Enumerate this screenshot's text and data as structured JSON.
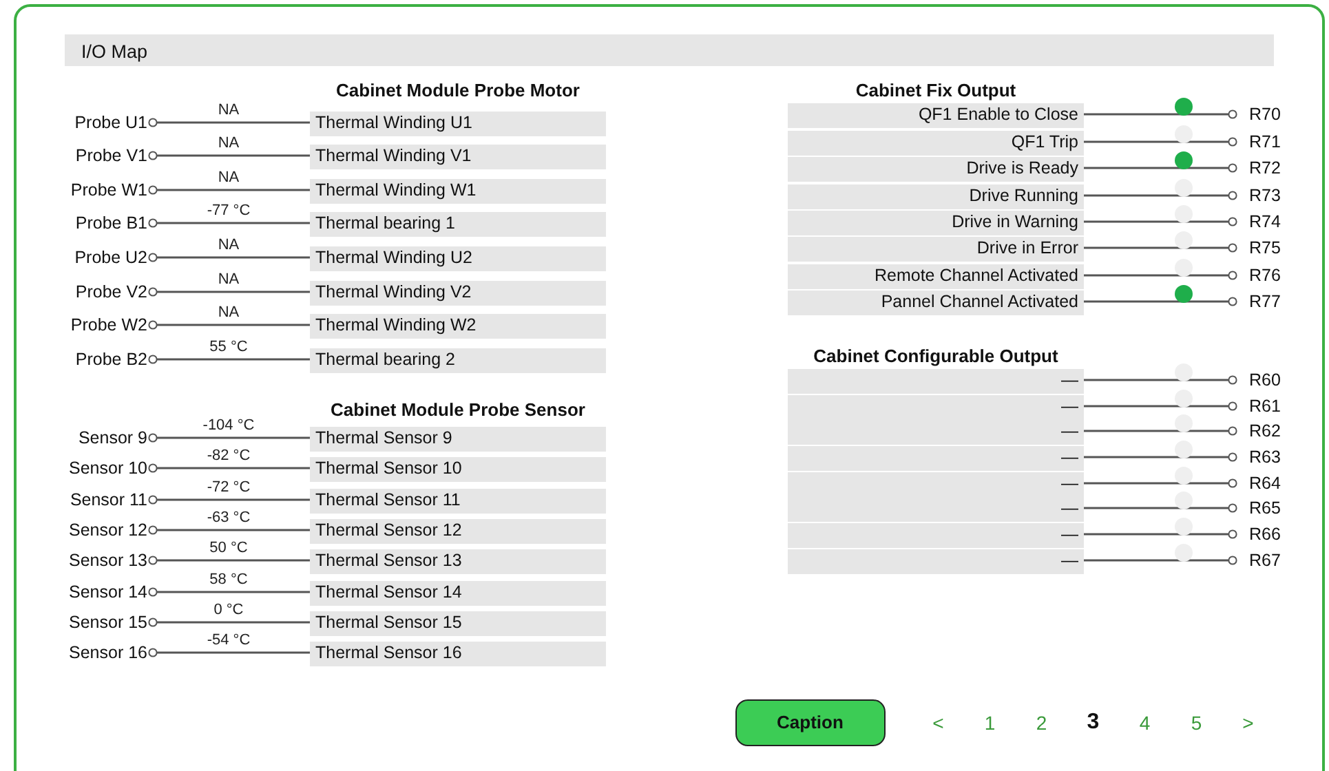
{
  "title": "I/O Map",
  "probe_motor": {
    "heading": "Cabinet Module Probe Motor",
    "rows": [
      {
        "label": "Probe U1",
        "value": "NA",
        "channel": "Thermal Winding U1"
      },
      {
        "label": "Probe V1",
        "value": "NA",
        "channel": "Thermal Winding V1"
      },
      {
        "label": "Probe W1",
        "value": "NA",
        "channel": "Thermal Winding W1"
      },
      {
        "label": "Probe B1",
        "value": "-77 °C",
        "channel": "Thermal bearing 1"
      },
      {
        "label": "Probe U2",
        "value": "NA",
        "channel": "Thermal Winding U2"
      },
      {
        "label": "Probe V2",
        "value": "NA",
        "channel": "Thermal Winding V2"
      },
      {
        "label": "Probe W2",
        "value": "NA",
        "channel": "Thermal Winding W2"
      },
      {
        "label": "Probe B2",
        "value": "55 °C",
        "channel": "Thermal bearing 2"
      }
    ]
  },
  "probe_sensor": {
    "heading": "Cabinet Module Probe Sensor",
    "rows": [
      {
        "label": "Sensor 9",
        "value": "-104 °C",
        "channel": "Thermal Sensor 9"
      },
      {
        "label": "Sensor 10",
        "value": "-82 °C",
        "channel": "Thermal Sensor 10"
      },
      {
        "label": "Sensor 11",
        "value": "-72 °C",
        "channel": "Thermal Sensor 11"
      },
      {
        "label": "Sensor 12",
        "value": "-63 °C",
        "channel": "Thermal Sensor 12"
      },
      {
        "label": "Sensor 13",
        "value": "50 °C",
        "channel": "Thermal Sensor 13"
      },
      {
        "label": "Sensor 14",
        "value": "58 °C",
        "channel": "Thermal Sensor 14"
      },
      {
        "label": "Sensor 15",
        "value": "0 °C",
        "channel": "Thermal Sensor 15"
      },
      {
        "label": "Sensor 16",
        "value": "-54 °C",
        "channel": "Thermal Sensor 16"
      }
    ]
  },
  "fix_output": {
    "heading": "Cabinet Fix Output",
    "rows": [
      {
        "label": "QF1 Enable to Close",
        "on": true,
        "terminal": "R70"
      },
      {
        "label": "QF1 Trip",
        "on": false,
        "terminal": "R71"
      },
      {
        "label": "Drive is Ready",
        "on": true,
        "terminal": "R72"
      },
      {
        "label": "Drive Running",
        "on": false,
        "terminal": "R73"
      },
      {
        "label": "Drive in Warning",
        "on": false,
        "terminal": "R74"
      },
      {
        "label": "Drive in Error",
        "on": false,
        "terminal": "R75"
      },
      {
        "label": "Remote Channel Activated",
        "on": false,
        "terminal": "R76"
      },
      {
        "label": "Pannel Channel Activated",
        "on": true,
        "terminal": "R77"
      }
    ]
  },
  "configurable_output": {
    "heading": "Cabinet Configurable Output",
    "rows": [
      {
        "label": "—",
        "on": false,
        "terminal": "R60"
      },
      {
        "label": "—",
        "on": false,
        "terminal": "R61"
      },
      {
        "label": "—",
        "on": false,
        "terminal": "R62"
      },
      {
        "label": "—",
        "on": false,
        "terminal": "R63"
      },
      {
        "label": "—",
        "on": false,
        "terminal": "R64"
      },
      {
        "label": "—",
        "on": false,
        "terminal": "R65"
      },
      {
        "label": "—",
        "on": false,
        "terminal": "R66"
      },
      {
        "label": "—",
        "on": false,
        "terminal": "R67"
      }
    ]
  },
  "caption_button": "Caption",
  "pagination": {
    "prev": "<",
    "next": ">",
    "pages": [
      {
        "label": "1",
        "selected": false
      },
      {
        "label": "2",
        "selected": false
      },
      {
        "label": "3",
        "selected": true
      },
      {
        "label": "4",
        "selected": false
      },
      {
        "label": "5",
        "selected": false
      }
    ]
  }
}
